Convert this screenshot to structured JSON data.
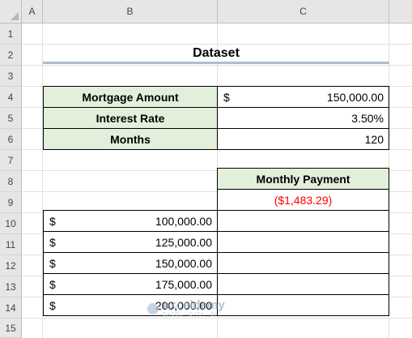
{
  "sheet": {
    "columns": [
      "A",
      "B",
      "C"
    ],
    "rows": [
      "1",
      "2",
      "3",
      "4",
      "5",
      "6",
      "7",
      "8",
      "9",
      "10",
      "11",
      "12",
      "13",
      "14",
      "15"
    ]
  },
  "title": "Dataset",
  "inputs": [
    {
      "label": "Mortgage Amount",
      "currency": "$",
      "value": "150,000.00"
    },
    {
      "label": "Interest Rate",
      "currency": "",
      "value": "3.50%"
    },
    {
      "label": "Months",
      "currency": "",
      "value": "120"
    }
  ],
  "payment": {
    "header": "Monthly Payment",
    "result": "($1,483.29)"
  },
  "amounts": [
    {
      "currency": "$",
      "value": "100,000.00"
    },
    {
      "currency": "$",
      "value": "125,000.00"
    },
    {
      "currency": "$",
      "value": "150,000.00"
    },
    {
      "currency": "$",
      "value": "175,000.00"
    },
    {
      "currency": "$",
      "value": "200,000.00"
    }
  ],
  "watermark": {
    "name": "exceldemy",
    "tagline": "EXCEL · DATA · BI"
  },
  "colors": {
    "header_fill": "#e2efda",
    "negative": "#ff0000",
    "title_rule": "#aebbd6"
  }
}
